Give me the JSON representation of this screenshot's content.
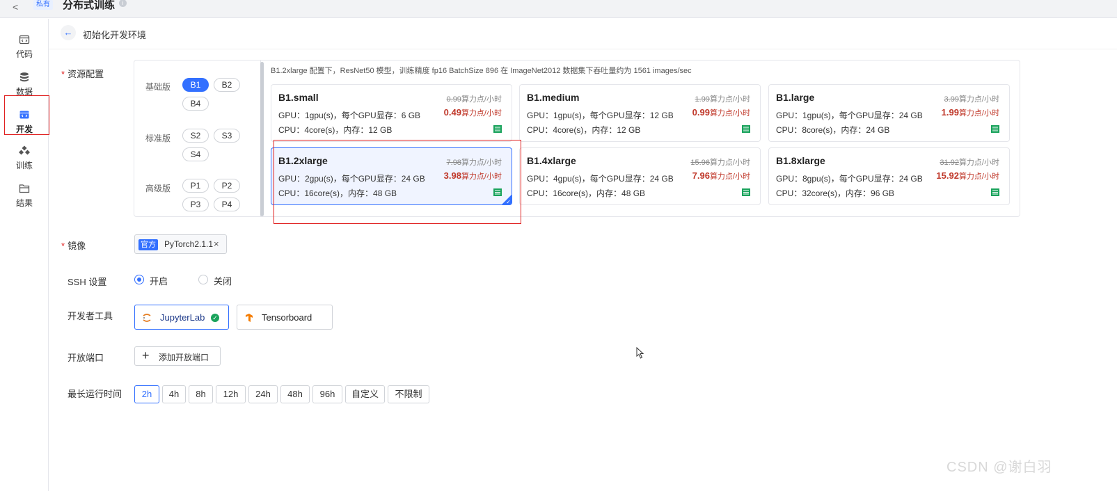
{
  "topbar": {
    "back": "<",
    "tag": "私有",
    "title": "分布式训练",
    "info": "i"
  },
  "sidebar": {
    "items": [
      {
        "label": "代码",
        "icon": "code-icon"
      },
      {
        "label": "数据",
        "icon": "database-icon"
      },
      {
        "label": "开发",
        "icon": "develop-icon",
        "active": true
      },
      {
        "label": "训练",
        "icon": "training-icon"
      },
      {
        "label": "结果",
        "icon": "folder-icon"
      }
    ]
  },
  "header": {
    "back": "←",
    "title": "初始化开发环境"
  },
  "form": {
    "resource_label": "资源配置",
    "image_label": "镜像",
    "ssh_label": "SSH 设置",
    "tools_label": "开发者工具",
    "port_label": "开放端口",
    "duration_label": "最长运行时间",
    "required_mark": "*"
  },
  "resource": {
    "note": "B1.2xlarge 配置下，ResNet50 模型，训练精度 fp16 BatchSize 896 在 ImageNet2012 数据集下吞吐量约为 1561 images/sec",
    "tiers": [
      {
        "label": "基础版",
        "options": [
          "B1",
          "B2",
          "B4"
        ],
        "selected": "B1"
      },
      {
        "label": "标准版",
        "options": [
          "S2",
          "S3",
          "S4"
        ]
      },
      {
        "label": "高级版",
        "options": [
          "P1",
          "P2",
          "P3",
          "P4"
        ]
      }
    ],
    "cards": [
      {
        "name": "B1.small",
        "old_price": "0.99",
        "old_unit": "算力点/小时",
        "price": "0.49",
        "unit": "算力点/小时",
        "gpu": "GPU：1gpu(s)，每个GPU显存：6 GB",
        "cpu": "CPU：4core(s)，内存：12 GB"
      },
      {
        "name": "B1.medium",
        "old_price": "1.99",
        "old_unit": "算力点/小时",
        "price": "0.99",
        "unit": "算力点/小时",
        "gpu": "GPU：1gpu(s)，每个GPU显存：12 GB",
        "cpu": "CPU：4core(s)，内存：12 GB"
      },
      {
        "name": "B1.large",
        "old_price": "3.99",
        "old_unit": "算力点/小时",
        "price": "1.99",
        "unit": "算力点/小时",
        "gpu": "GPU：1gpu(s)，每个GPU显存：24 GB",
        "cpu": "CPU：8core(s)，内存：24 GB"
      },
      {
        "name": "B1.2xlarge",
        "old_price": "7.98",
        "old_unit": "算力点/小时",
        "price": "3.98",
        "unit": "算力点/小时",
        "gpu": "GPU：2gpu(s)，每个GPU显存：24 GB",
        "cpu": "CPU：16core(s)，内存：48 GB",
        "selected": true
      },
      {
        "name": "B1.4xlarge",
        "old_price": "15.96",
        "old_unit": "算力点/小时",
        "price": "7.96",
        "unit": "算力点/小时",
        "gpu": "GPU：4gpu(s)，每个GPU显存：24 GB",
        "cpu": "CPU：16core(s)，内存：48 GB"
      },
      {
        "name": "B1.8xlarge",
        "old_price": "31.92",
        "old_unit": "算力点/小时",
        "price": "15.92",
        "unit": "算力点/小时",
        "gpu": "GPU：8gpu(s)，每个GPU显存：24 GB",
        "cpu": "CPU：32core(s)，内存：96 GB"
      }
    ]
  },
  "image": {
    "badge": "官方",
    "name": "PyTorch2.1.1",
    "remove": "×"
  },
  "ssh": {
    "on": "开启",
    "off": "关闭",
    "selected": "on"
  },
  "tools": {
    "jupyter": "JupyterLab",
    "tensorboard": "Tensorboard",
    "check": "✓"
  },
  "port": {
    "add_label": "添加开放端口",
    "plus": "+"
  },
  "duration": {
    "options": [
      "2h",
      "4h",
      "8h",
      "12h",
      "24h",
      "48h",
      "96h",
      "自定义",
      "不限制"
    ],
    "selected": "2h"
  },
  "watermark": "CSDN @谢白羽",
  "colors": {
    "accent": "#3370ff",
    "price": "#c0392b",
    "annotation": "#e02020",
    "stock": "#1aa35c"
  }
}
